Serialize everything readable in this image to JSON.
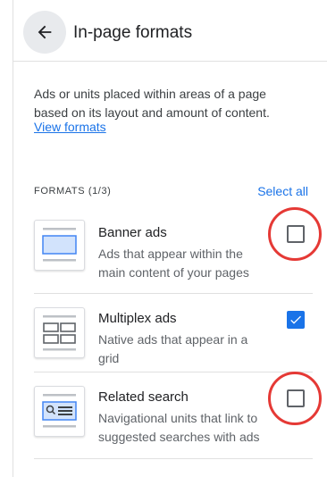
{
  "header": {
    "title": "In-page formats",
    "back_icon": "arrow-back-icon"
  },
  "description": "Ads or units placed within areas of a page based on its layout and amount of content.",
  "view_formats_link": "View formats",
  "formats_label": "FORMATS (1/3)",
  "select_all_label": "Select all",
  "formats": [
    {
      "title": "Banner ads",
      "description": "Ads that appear within the main content of your pages",
      "checked": false,
      "highlighted": true
    },
    {
      "title": "Multiplex ads",
      "description": "Native ads that appear in a grid",
      "checked": true,
      "highlighted": false
    },
    {
      "title": "Related search",
      "description": "Navigational units that link to suggested searches with ads",
      "checked": false,
      "highlighted": true
    }
  ],
  "colors": {
    "accent": "#1a73e8",
    "highlight_ring": "#e53935"
  }
}
